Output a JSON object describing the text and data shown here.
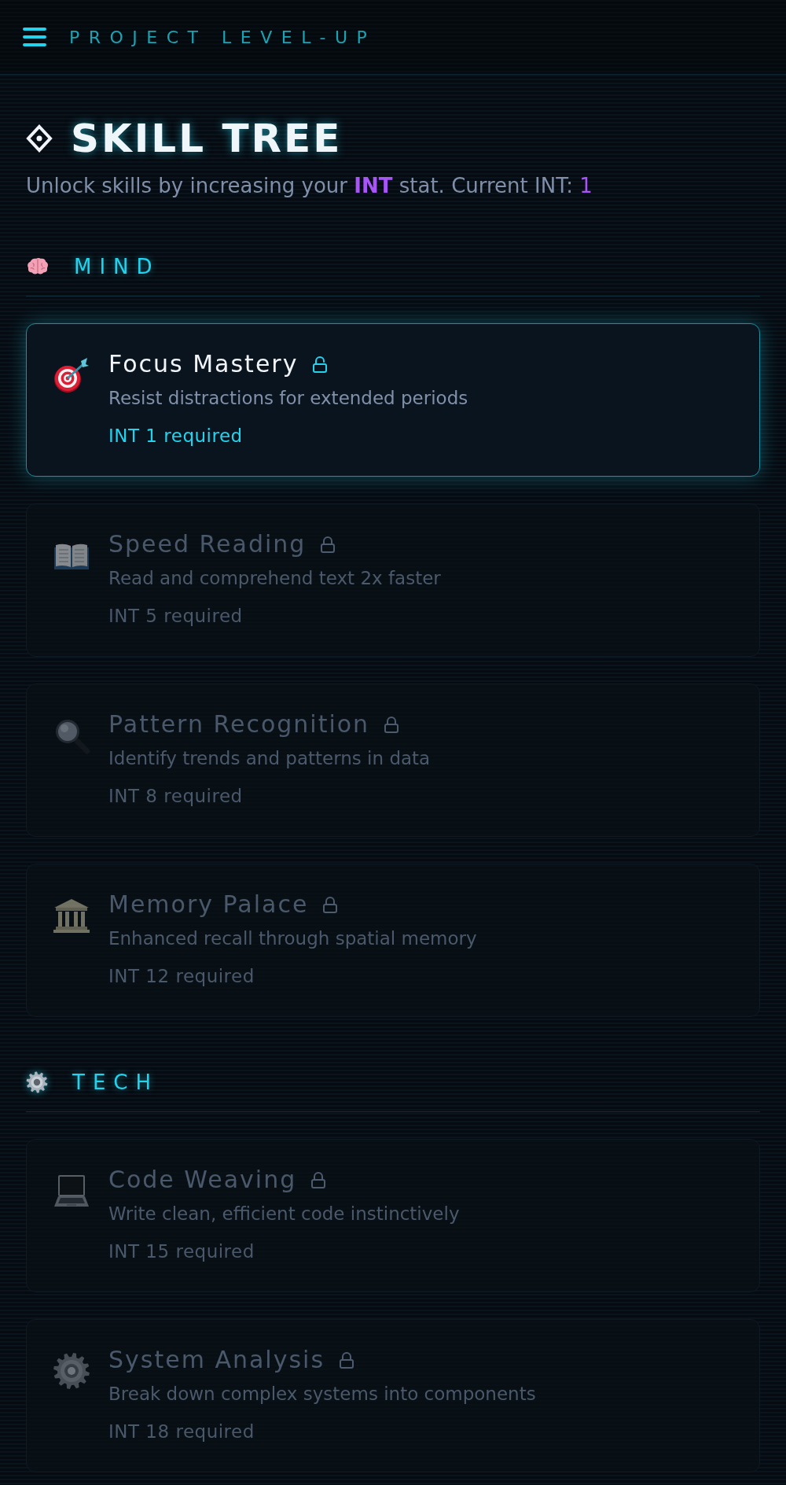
{
  "header": {
    "title": "PROJECT LEVEL-UP"
  },
  "page": {
    "title": "SKILL TREE",
    "subtitle": "Unlock skills by increasing your **INT** stat. Current INT:",
    "current_int": "1"
  },
  "sections": [
    {
      "title": "MIND",
      "skills": [
        {
          "name": "Focus Mastery",
          "description": "Resist distractions for extended periods",
          "requirement": "INT 1 required",
          "unlocked": true
        },
        {
          "name": "Speed Reading",
          "description": "Read and comprehend text 2x faster",
          "requirement": "INT 5 required",
          "unlocked": false
        },
        {
          "name": "Pattern Recognition",
          "description": "Identify trends and patterns in data",
          "requirement": "INT 8 required",
          "unlocked": false
        },
        {
          "name": "Memory Palace",
          "description": "Enhanced recall through spatial memory",
          "requirement": "INT 12 required",
          "unlocked": false
        }
      ]
    },
    {
      "title": "TECH",
      "skills": [
        {
          "name": "Code Weaving",
          "description": "Write clean, efficient code instinctively",
          "requirement": "INT 15 required",
          "unlocked": false
        },
        {
          "name": "System Analysis",
          "description": "Break down complex systems into components",
          "requirement": "INT 18 required",
          "unlocked": false
        }
      ]
    }
  ]
}
